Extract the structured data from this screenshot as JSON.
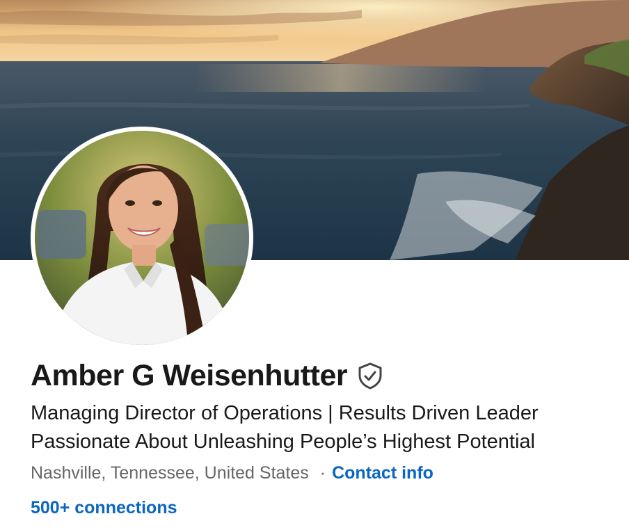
{
  "profile": {
    "name": "Amber G Weisenhutter",
    "verified_icon": "shield-check-icon",
    "headline_line1": "Managing Director of Operations | Results Driven Leader",
    "headline_line2": "Passionate About Unleashing People’s Highest Potential",
    "location": "Nashville, Tennessee, United States",
    "separator": "·",
    "contact_info_label": "Contact info",
    "connections_label": "500+ connections"
  },
  "colors": {
    "link": "#0a66c2",
    "text_primary": "#191919",
    "text_secondary": "#666666"
  }
}
